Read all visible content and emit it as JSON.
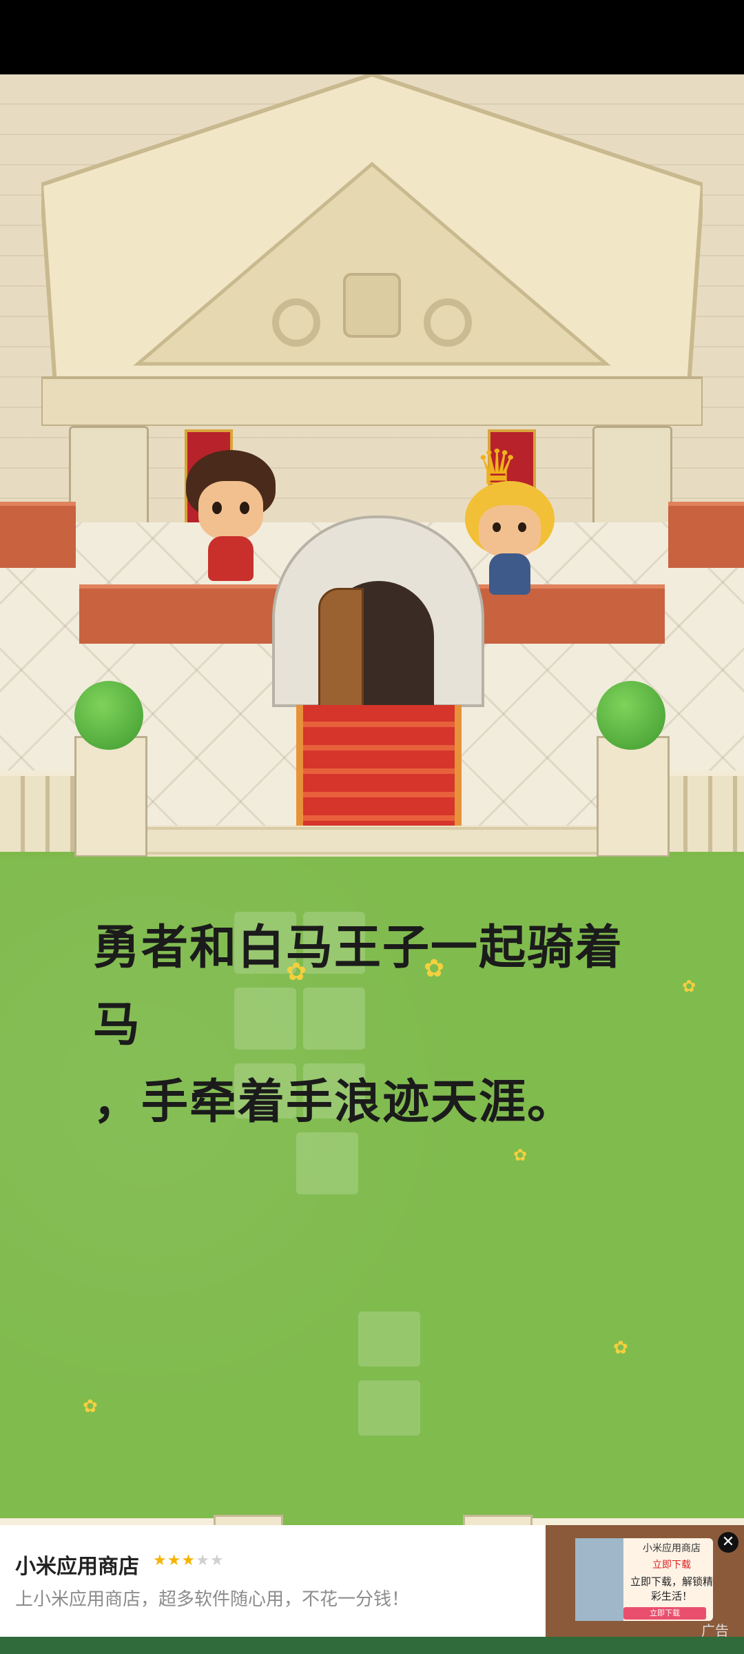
{
  "story": {
    "text": "勇者和白马王子一起骑着马\n，手牵着手浪迹天涯。"
  },
  "ad": {
    "app_name": "小米应用商店",
    "rating_stars": "★★★★★",
    "rating_value": 3,
    "rating_max": 5,
    "description": "上小米应用商店，超多软件随心用，不花一分钱！",
    "card_title": "小米应用商店",
    "card_download": "立即下载",
    "card_promo": "立即下载，解锁精彩生活！",
    "card_button": "立即下载",
    "close_icon": "close-icon",
    "tag": "广告"
  },
  "colors": {
    "grass": "#80bb4e",
    "carpet": "#d5352a",
    "rating_filled": "#f5b400",
    "rating_empty": "#d0d0d0"
  }
}
